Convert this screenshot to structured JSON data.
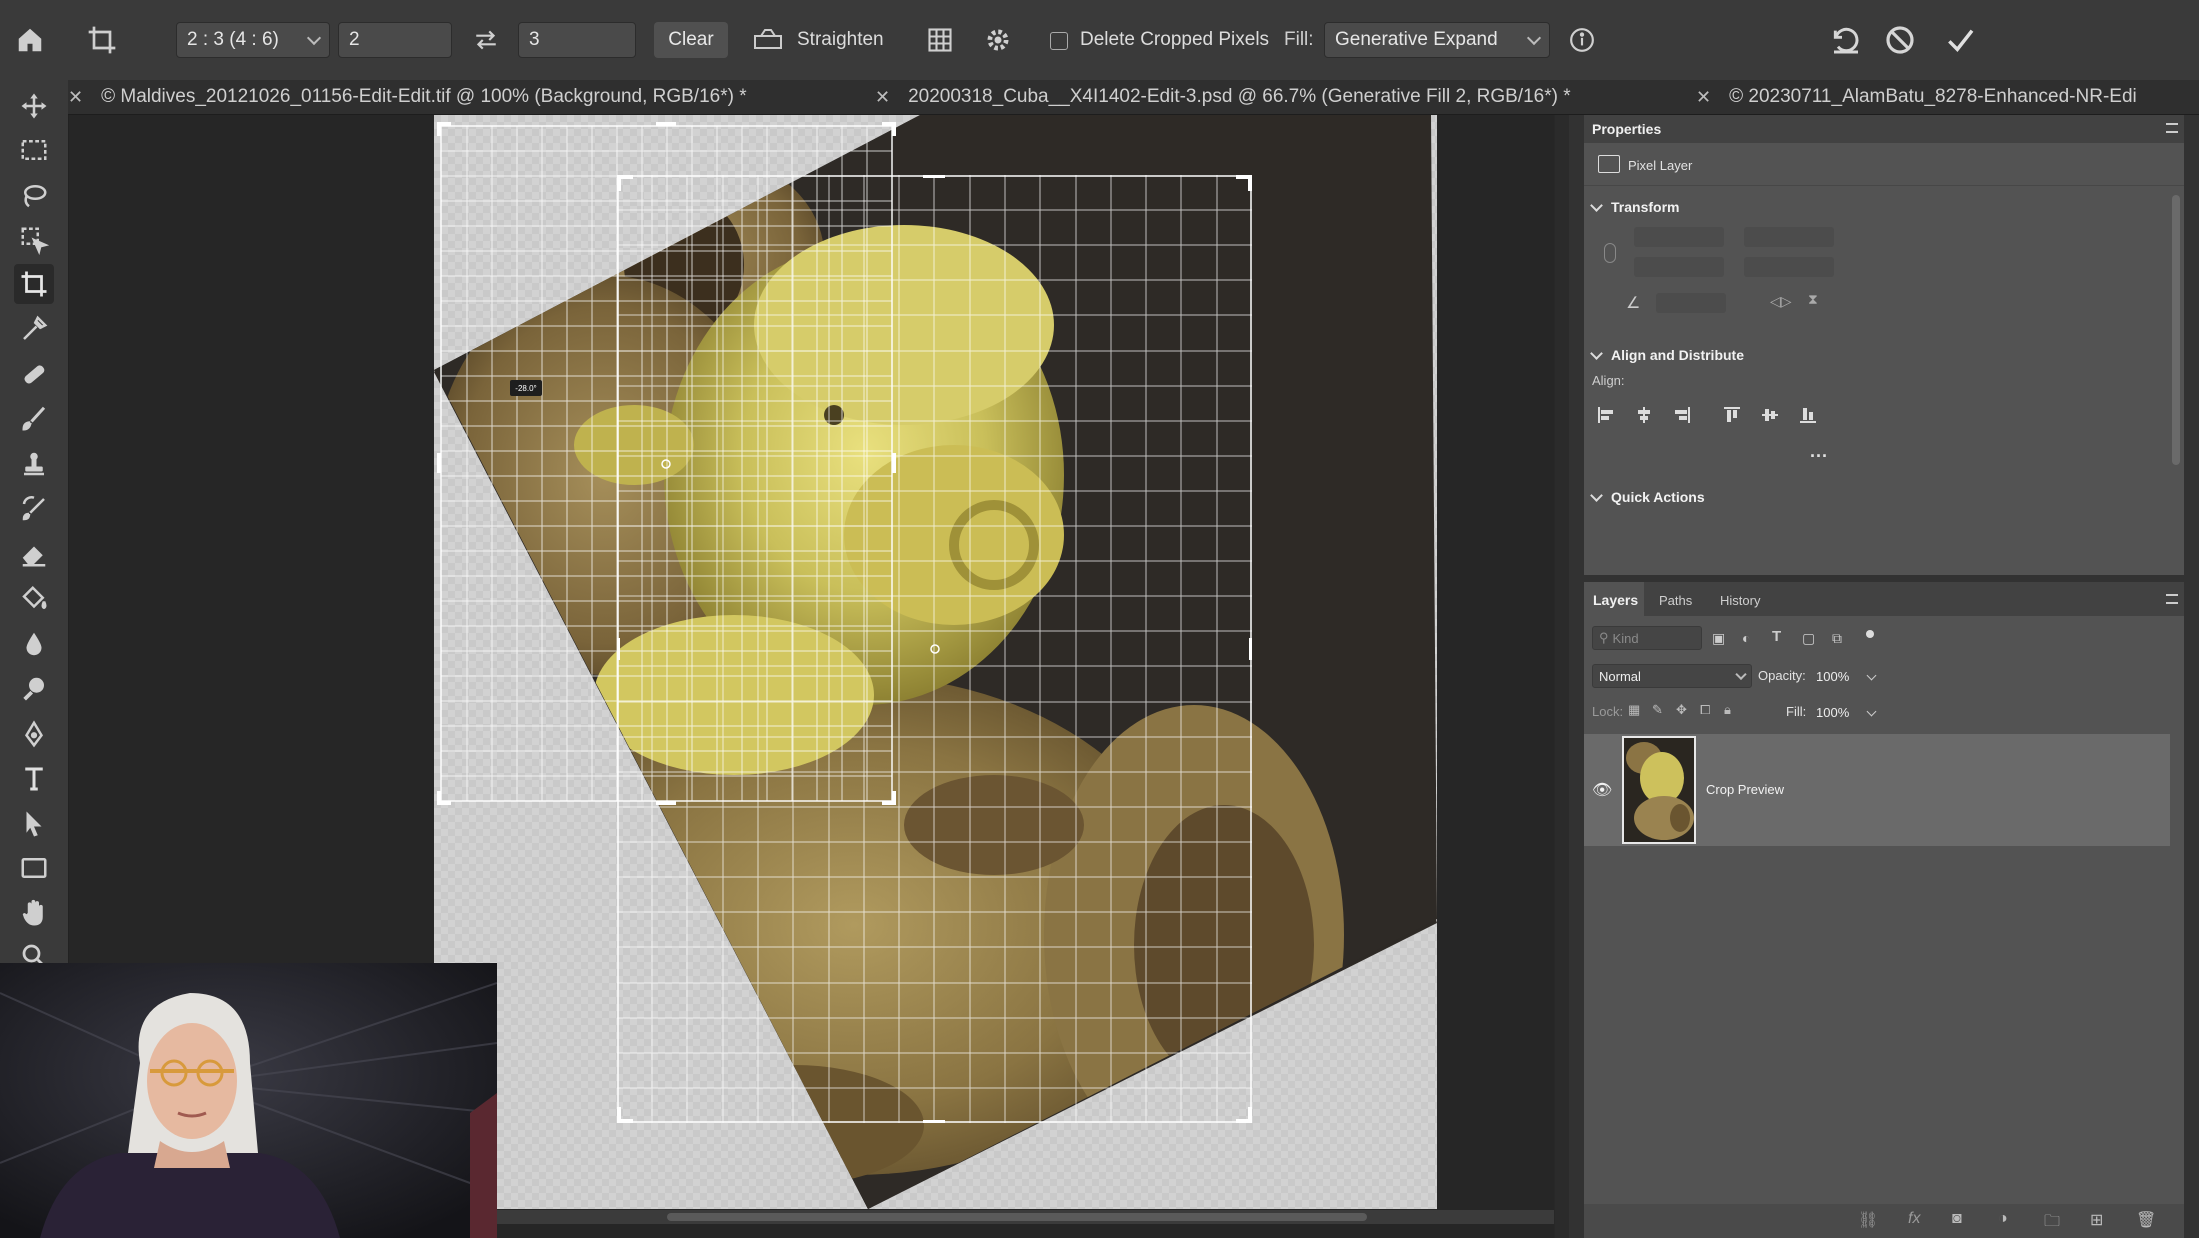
{
  "options_bar": {
    "ratio_preset": "2 : 3 (4 : 6)",
    "ratio_width": "2",
    "ratio_height": "3",
    "clear_label": "Clear",
    "straighten_label": "Straighten",
    "delete_cropped_label": "Delete Cropped Pixels",
    "fill_label": "Fill:",
    "fill_value": "Generative Expand"
  },
  "tabs": [
    {
      "label": "© Maldives_20121026_01156-Edit-Edit.tif @ 100% (Background, RGB/16*) *"
    },
    {
      "label": "20200318_Cuba__X4I1402-Edit-3.psd @ 66.7% (Generative Fill 2, RGB/16*) *"
    },
    {
      "label": "© 20230711_AlamBatu_8278-Enhanced-NR-Edi"
    }
  ],
  "canvas": {
    "angle_readout": "-28.0°"
  },
  "properties": {
    "title": "Properties",
    "layer_kind": "Pixel Layer",
    "transform_label": "Transform",
    "align_label": "Align and Distribute",
    "align_sub": "Align:",
    "more": "...",
    "quick_actions_label": "Quick Actions"
  },
  "layers_panel": {
    "tabs": [
      "Layers",
      "Paths",
      "History"
    ],
    "kind_placeholder": "Kind",
    "blend_mode": "Normal",
    "opacity_label": "Opacity:",
    "opacity_value": "100%",
    "lock_label": "Lock:",
    "fill_label": "Fill:",
    "fill_value": "100%",
    "layers": [
      {
        "name": "Crop Preview",
        "visible": true
      }
    ]
  },
  "colors": {
    "accent": "#c9c23a",
    "panel_bg": "#535353",
    "toolbar_bg": "#3a3a3a"
  }
}
